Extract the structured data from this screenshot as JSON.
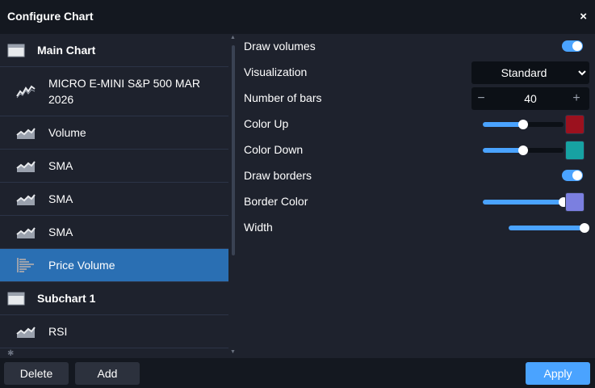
{
  "window": {
    "title": "Configure Chart",
    "close_glyph": "×"
  },
  "sidebar": {
    "groups": [
      {
        "label": "Main Chart",
        "icon": "chart-window-icon",
        "items": [
          {
            "label": "MICRO E-MINI S&P 500 MAR 2026",
            "icon": "price-line-icon"
          },
          {
            "label": "Volume",
            "icon": "indicator-area-icon"
          },
          {
            "label": "SMA",
            "icon": "indicator-area-icon"
          },
          {
            "label": "SMA",
            "icon": "indicator-area-icon"
          },
          {
            "label": "SMA",
            "icon": "indicator-area-icon"
          },
          {
            "label": "Price Volume",
            "icon": "volume-profile-icon",
            "selected": true
          }
        ]
      },
      {
        "label": "Subchart 1",
        "icon": "chart-window-icon",
        "items": [
          {
            "label": "RSI",
            "icon": "indicator-area-icon"
          }
        ]
      }
    ]
  },
  "settings": {
    "draw_volumes": {
      "label": "Draw volumes",
      "enabled": true
    },
    "visualization": {
      "label": "Visualization",
      "value": "Standard"
    },
    "number_of_bars": {
      "label": "Number of bars",
      "value": "40",
      "minus": "−",
      "plus": "+"
    },
    "color_up": {
      "label": "Color Up",
      "color": "#9b111e",
      "opacity": 0.5
    },
    "color_down": {
      "label": "Color Down",
      "color": "#17a2a2",
      "opacity": 0.5
    },
    "draw_borders": {
      "label": "Draw borders",
      "enabled": true
    },
    "border_color": {
      "label": "Border Color",
      "color": "#7b7fe0",
      "opacity": 1.0
    },
    "width": {
      "label": "Width",
      "value": 1.0
    }
  },
  "footer": {
    "delete_label": "Delete",
    "add_label": "Add",
    "apply_label": "Apply"
  },
  "colors": {
    "accent": "#4aa3ff",
    "selected": "#2a6fb3",
    "background": "#1e222d",
    "header": "#141820"
  }
}
